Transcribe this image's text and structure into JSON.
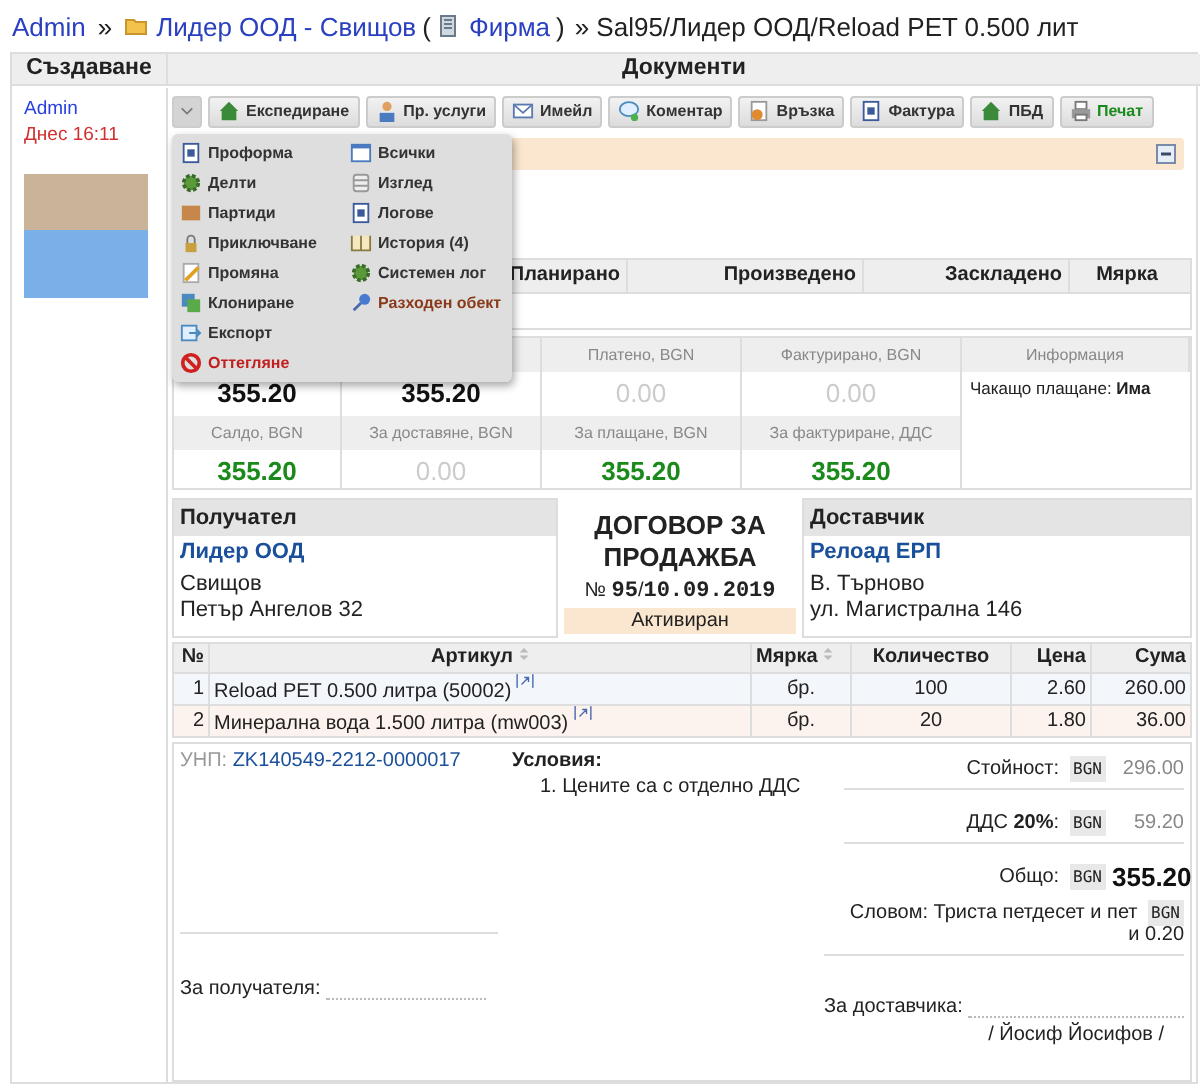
{
  "breadcrumb": {
    "root": "Admin",
    "separator": "»",
    "company": "Лидер ООД - Свищов",
    "open_paren": "(",
    "company_type": "Фирма",
    "close_paren": ")",
    "current": "» Sal95/Лидер ООД/Reload PET 0.500 лит"
  },
  "header": {
    "left": "Създаване",
    "right": "Документи"
  },
  "creator": {
    "user": "Admin",
    "time": "Днес 16:11"
  },
  "toolbar": {
    "menu_expanded": true,
    "buttons": [
      {
        "label": "Експедиране",
        "kind": "default"
      },
      {
        "label": "Пр. услуги",
        "kind": "default"
      },
      {
        "label": "Имейл",
        "kind": "default"
      },
      {
        "label": "Коментар",
        "kind": "default"
      },
      {
        "label": "Връзка",
        "kind": "default"
      },
      {
        "label": "Фактура",
        "kind": "default"
      },
      {
        "label": "ПБД",
        "kind": "default"
      },
      {
        "label": "Печат",
        "kind": "accent"
      }
    ]
  },
  "menu": {
    "columns": [
      [
        {
          "label": "Проформа",
          "kind": "default"
        },
        {
          "label": "Делти",
          "kind": "default"
        },
        {
          "label": "Партиди",
          "kind": "default"
        },
        {
          "label": "Приключване",
          "kind": "default"
        },
        {
          "label": "Промяна",
          "kind": "default"
        },
        {
          "label": "Клониране",
          "kind": "default"
        },
        {
          "label": "Експорт",
          "kind": "default"
        },
        {
          "label": "Оттегляне",
          "kind": "danger"
        }
      ],
      [
        {
          "label": "Всички",
          "kind": "default"
        },
        {
          "label": "Изглед",
          "kind": "default"
        },
        {
          "label": "Логове",
          "kind": "default"
        },
        {
          "label": "История (4)",
          "kind": "default"
        },
        {
          "label": "Системен лог",
          "kind": "default"
        },
        {
          "label": "Разходен обект",
          "kind": "warning"
        }
      ]
    ]
  },
  "production_table": {
    "columns": [
      "Планирано",
      "Произведено",
      "Заскладено",
      "Мярка"
    ]
  },
  "summary": {
    "row_1": [
      {
        "value": "355.20",
        "kind": "total"
      },
      {
        "value": "355.20",
        "kind": "total"
      },
      {
        "label": "Платено, BGN",
        "value": "0.00",
        "kind": "zero"
      },
      {
        "label": "Фактурирано, BGN",
        "value": "0.00",
        "kind": "zero"
      }
    ],
    "row_2": [
      {
        "label": "Салдо, BGN",
        "value": "355.20",
        "kind": "positive"
      },
      {
        "label": "За доставяне, BGN",
        "value": "0.00",
        "kind": "zero"
      },
      {
        "label": "За плащане, BGN",
        "value": "355.20",
        "kind": "positive"
      },
      {
        "label": "За фактуриране, ДДС",
        "value": "355.20",
        "kind": "positive"
      }
    ],
    "info": {
      "label": "Информация",
      "text": "Чакащо плащане: **Има**"
    }
  },
  "document": {
    "recipient": {
      "heading": "Получател",
      "name": "Лидер ООД",
      "lines": [
        "Свищов",
        "Петър Ангелов 32"
      ]
    },
    "title": "ДОГОВОР ЗА ПРОДАЖБА",
    "number_prefix": "№",
    "number": "95",
    "separator": "/",
    "date": "10.09.2019",
    "status": "Активиран",
    "supplier": {
      "heading": "Доставчик",
      "name": "Релоад ЕРП",
      "lines": [
        "В. Търново",
        "ул. Магистрална 146"
      ]
    }
  },
  "items": {
    "columns": [
      {
        "label": "№",
        "sortable": false
      },
      {
        "label": "Артикул",
        "sortable": true
      },
      {
        "label": "Мярка",
        "sortable": true
      },
      {
        "label": "Количество",
        "sortable": false
      },
      {
        "label": "Цена",
        "sortable": false
      },
      {
        "label": "Сума",
        "sortable": false
      }
    ],
    "rows": [
      {
        "no": "1",
        "article": "Reload PET 0.500 литра (50002)",
        "unit": "бр.",
        "quantity": "100",
        "price": "2.60",
        "amount": "260.00"
      },
      {
        "no": "2",
        "article": "Минерална вода 1.500 литра (mw003)",
        "unit": "бр.",
        "quantity": "20",
        "price": "1.80",
        "amount": "36.00"
      }
    ]
  },
  "footer": {
    "reg_label": "УНП:",
    "reg_number": "ZK140549-2212-0000017",
    "conditions_heading": "Условия:",
    "conditions": [
      "1. Цените са с отделно ДДС"
    ],
    "totals": [
      {
        "label": "Стойност:",
        "currency": "BGN",
        "amount": "296.00",
        "kind": "subtotal"
      },
      {
        "label": "ДДС **20%**:",
        "currency": "BGN",
        "amount": "59.20",
        "kind": "subtotal"
      },
      {
        "label": "Общо:",
        "currency": "BGN",
        "amount": "355.20",
        "kind": "total"
      }
    ],
    "in_words": {
      "text": "Словом: Триста петдесет и пет",
      "currency": "BGN",
      "rest": "и 0.20"
    },
    "recipient_sign": "За получателя:",
    "supplier_sign": "За доставчика:",
    "supplier_signatory": "/ Йосиф Йосифов /"
  }
}
